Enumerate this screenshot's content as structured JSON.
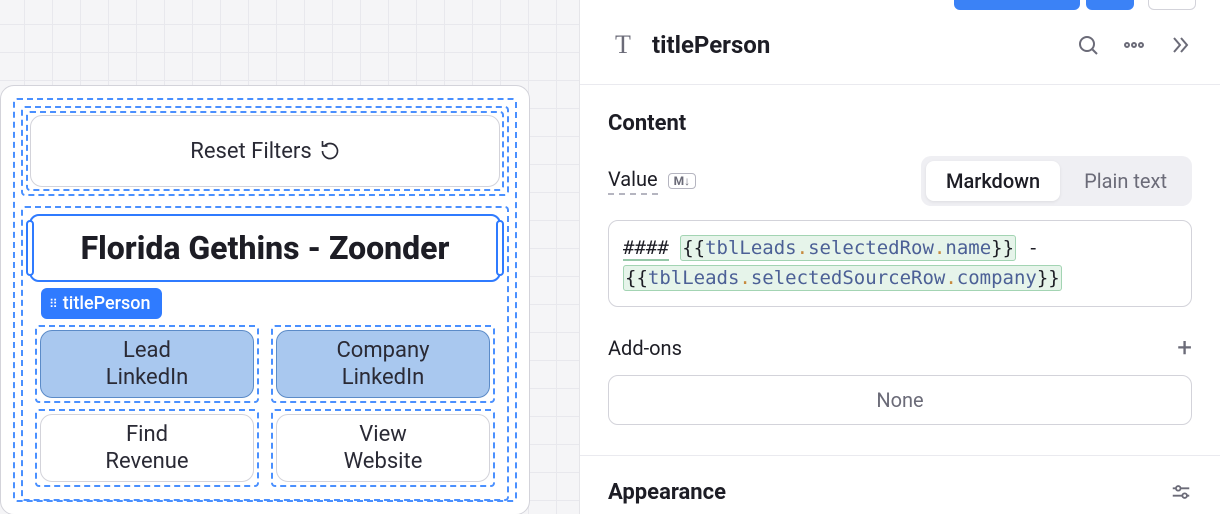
{
  "canvas": {
    "reset_label": "Reset Filters",
    "title_text": "Florida Gethins - Zoonder",
    "selection_tag": "titlePerson",
    "buttons": {
      "lead_linkedin": "Lead LinkedIn",
      "company_linkedin": "Company LinkedIn",
      "find_revenue": "Find Revenue",
      "view_website": "View Website"
    }
  },
  "inspector": {
    "component_name": "titlePerson",
    "sections": {
      "content": "Content",
      "value_label": "Value",
      "md_badge": "M↓",
      "segmented": {
        "markdown": "Markdown",
        "plain": "Plain text"
      },
      "code": {
        "prefix": "####",
        "t1_obj": "tblLeads",
        "t1_prop1": "selectedRow",
        "t1_prop2": "name",
        "sep": " - ",
        "t2_obj": "tblLeads",
        "t2_prop1": "selectedSourceRow",
        "t2_prop2": "company"
      },
      "addons_label": "Add-ons",
      "addons_none": "None",
      "appearance_label": "Appearance"
    }
  }
}
